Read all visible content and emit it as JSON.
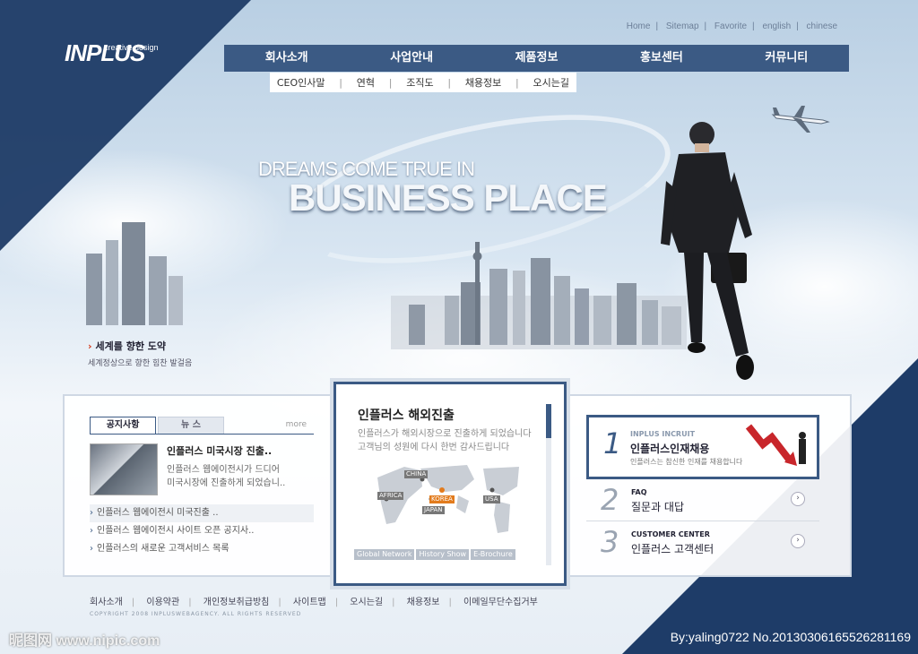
{
  "brand": {
    "logo_small": "creative design",
    "logo_main": "INPLUS"
  },
  "top_links": [
    "Home",
    "Sitemap",
    "Favorite",
    "english",
    "chinese"
  ],
  "nav": [
    "회사소개",
    "사업안내",
    "제품정보",
    "홍보센터",
    "커뮤니티"
  ],
  "subnav": [
    "CEO인사말",
    "연혁",
    "조직도",
    "채용정보",
    "오시는길"
  ],
  "hero": {
    "line1": "DREAMS COME TRUE IN",
    "line2": "BUSINESS PLACE"
  },
  "sky_caption": {
    "title": "세계를 향한 도약",
    "subtitle": "세계정상으로 향한 힘찬 발걸음"
  },
  "notice": {
    "tab_active": "공지사항",
    "tab_inactive": "뉴    스",
    "more": "more",
    "featured_title": "인플러스 미국시장 진출..",
    "featured_body_1": "인플러스 웹에이전시가 드디어",
    "featured_body_2": "미국시장에 진출하게 되었습니..",
    "items": [
      "인플러스 웹에이전시 미국진출 ..",
      "인플러스 웹에이전시 사이트 오픈 공지사..",
      "인플러스의 새로운 고객서비스 목록"
    ]
  },
  "overseas": {
    "title": "인플러스 해외진출",
    "desc_1": "인플러스가 해외시장으로 진출하게 되었습니다",
    "desc_2": "고객님의 성원에 다시 한번 감사드립니다",
    "map_labels": [
      "CHINA",
      "AFRICA",
      "KOREA",
      "JAPAN",
      "USA"
    ],
    "buttons": [
      "Global Network",
      "History Show",
      "E-Brochure"
    ]
  },
  "right_box": {
    "recruit": {
      "num": "1",
      "sub": "INPLUS INCRUIT",
      "title": "인플러스인재채용",
      "desc": "인플러스는 참신한 인재를 채용합니다"
    },
    "faq": {
      "num": "2",
      "sub": "FAQ",
      "title": "질문과 대답"
    },
    "customer": {
      "num": "3",
      "sub": "CUSTOMER CENTER",
      "title": "인플러스 고객센터"
    }
  },
  "footer": {
    "links": [
      "회사소개",
      "이용약관",
      "개인정보취급방침",
      "사이트맵",
      "오시는길",
      "채용정보",
      "이메일무단수집거부"
    ],
    "copyright": "COPYRIGHT 2008 INPLUSWEBAGENCY. ALL RIGHTS RESERVED"
  },
  "watermark": {
    "left": "昵图网 www.nipic.com",
    "right": "By:yaling0722 No.20130306165526281169"
  },
  "colors": {
    "navy": "#1d3b66",
    "nav": "#3b5a84",
    "accent_red": "#d53a1b",
    "korea_orange": "#e27b1d"
  }
}
